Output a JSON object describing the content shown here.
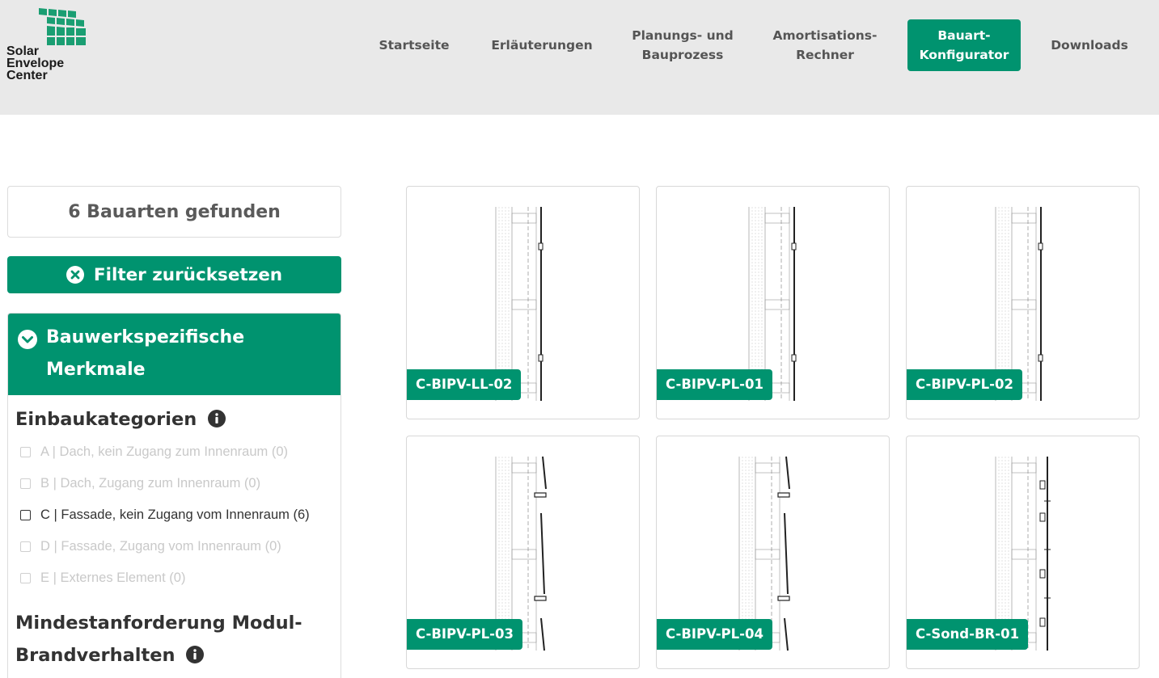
{
  "brand": {
    "line1": "Solar",
    "line2": "Envelope",
    "line3": "Center",
    "accent_color": "#00936f"
  },
  "nav": {
    "items": [
      {
        "label": "Startseite"
      },
      {
        "label": "Erläuterungen"
      },
      {
        "label": "Planungs- und Bauprozess"
      },
      {
        "label": "Amortisations-Rechner"
      },
      {
        "label": "Bauart-Konfigurator",
        "active": true
      },
      {
        "label": "Downloads"
      }
    ]
  },
  "sidebar": {
    "found_text": "6 Bauarten gefunden",
    "reset_label": "Filter zurücksetzen",
    "reset_icon": "close-circle-icon",
    "panel_title": "Bauwerkspezifische Merkmale",
    "panel_icon": "chevron-down-circle-icon",
    "categories_title": "Einbaukategorien",
    "categories": [
      {
        "label": "A | Dach, kein Zugang zum Innenraum (0)",
        "enabled": false
      },
      {
        "label": "B | Dach, Zugang zum Innenraum (0)",
        "enabled": false
      },
      {
        "label": "C | Fassade, kein Zugang vom Innenraum (6)",
        "enabled": true
      },
      {
        "label": "D | Fassade, Zugang vom Innenraum (0)",
        "enabled": false
      },
      {
        "label": "E | Externes Element (0)",
        "enabled": false
      }
    ],
    "fire_title_line1": "Mindestanforderung Modul-",
    "fire_title_line2": "Brandverhalten"
  },
  "results": {
    "cards": [
      {
        "label": "C-BIPV-LL-02"
      },
      {
        "label": "C-BIPV-PL-01"
      },
      {
        "label": "C-BIPV-PL-02"
      },
      {
        "label": "C-BIPV-PL-03"
      },
      {
        "label": "C-BIPV-PL-04"
      },
      {
        "label": "C-Sond-BR-01"
      }
    ]
  }
}
